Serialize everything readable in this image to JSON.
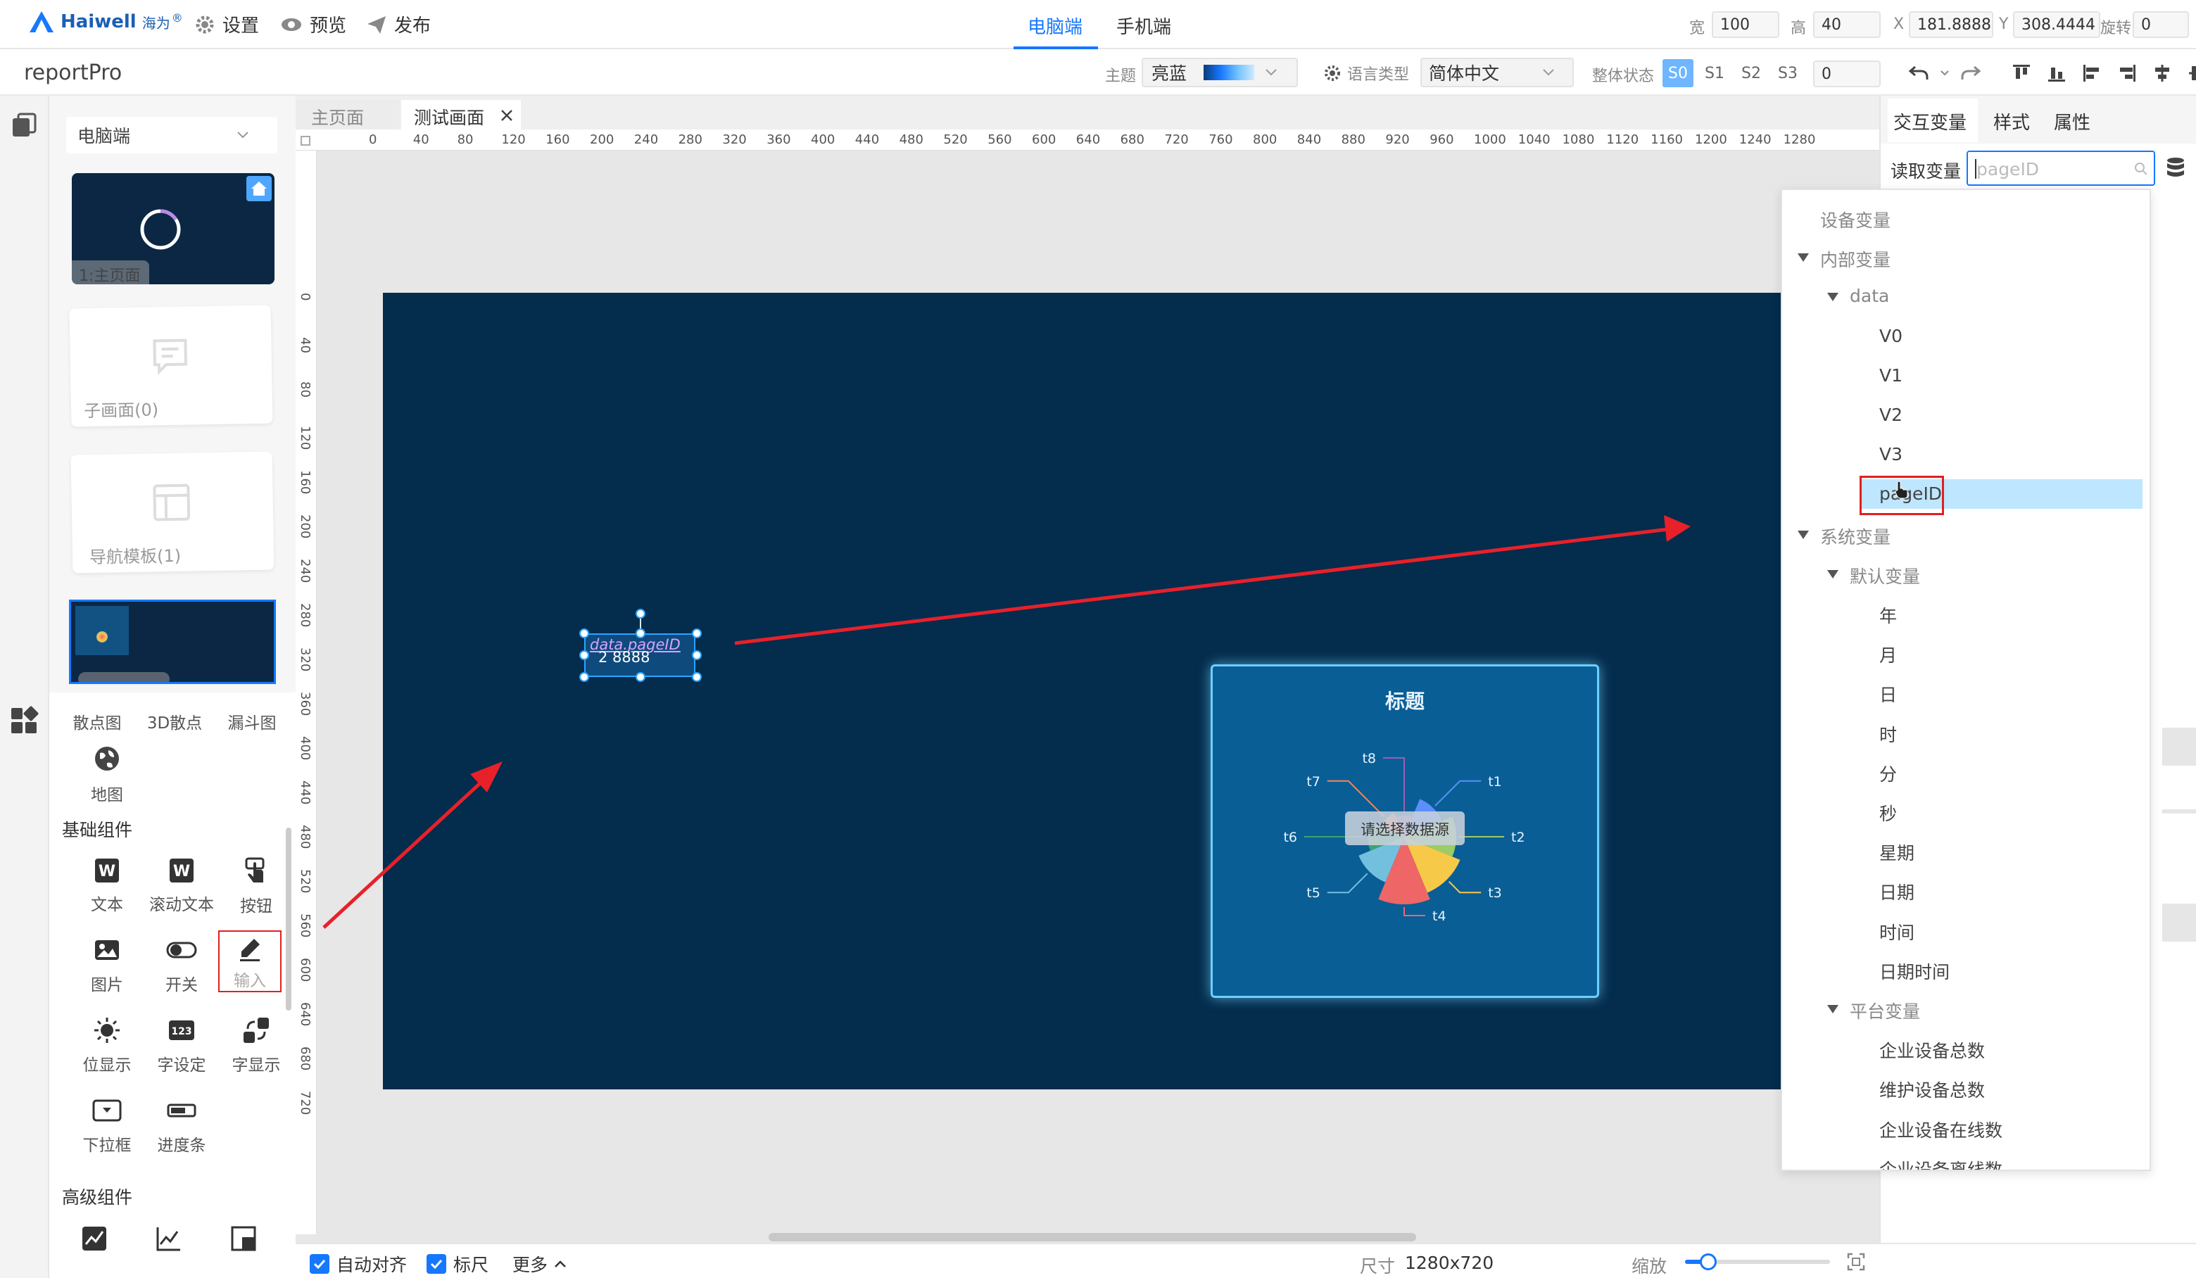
{
  "app": {
    "logo_text": "Haiwell",
    "logo_cn": "海为",
    "logo_mark": "®",
    "menu": {
      "settings": "设置",
      "preview": "预览",
      "publish": "发布"
    },
    "device_tabs": [
      {
        "label": "电脑端",
        "active": true
      },
      {
        "label": "手机端",
        "active": false
      }
    ],
    "project_name": "reportPro",
    "accent": "#1677ff"
  },
  "geometry_inputs": {
    "width_label": "宽",
    "width_value": "100",
    "height_label": "高",
    "height_value": "40",
    "x_label": "X",
    "x_value": "181.8888",
    "y_label": "Y",
    "y_value": "308.4444",
    "rotate_label": "旋转",
    "rotate_value": "0"
  },
  "toolbar": {
    "theme_label": "主题",
    "theme_value": "亮蓝",
    "lang_label": "语言类型",
    "lang_value": "简体中文",
    "state_label": "整体状态",
    "states": [
      "S0",
      "S1",
      "S2",
      "S3"
    ],
    "state_input": "0"
  },
  "left_panel": {
    "platform_select": "电脑端",
    "pages": [
      {
        "label": "1:主页面"
      },
      {
        "label": "子画面(0)"
      },
      {
        "label": "导航模板(1)"
      }
    ],
    "chart_components": [
      "散点图",
      "3D散点",
      "漏斗图"
    ],
    "map_component": "地图",
    "basic_title": "基础组件",
    "basic_components": [
      {
        "label": "文本",
        "icon": "word-icon"
      },
      {
        "label": "滚动文本",
        "icon": "word-icon"
      },
      {
        "label": "按钮",
        "icon": "hand-pointer-icon"
      },
      {
        "label": "图片",
        "icon": "image-icon"
      },
      {
        "label": "开关",
        "icon": "toggle-icon"
      },
      {
        "label": "输入",
        "icon": "pen-icon"
      },
      {
        "label": "位显示",
        "icon": "sun-icon"
      },
      {
        "label": "字设定",
        "icon": "number-123-icon"
      },
      {
        "label": "字显示",
        "icon": "cycle-icon"
      },
      {
        "label": "下拉框",
        "icon": "dropdown-icon"
      },
      {
        "label": "进度条",
        "icon": "progress-icon"
      }
    ],
    "advanced_title": "高级组件"
  },
  "page_tabs": [
    {
      "label": "主页面",
      "active": false
    },
    {
      "label": "测试画面",
      "active": true
    }
  ],
  "ruler_h": [
    "0",
    "40",
    "80",
    "120",
    "160",
    "200",
    "240",
    "280",
    "320",
    "360",
    "400",
    "440",
    "480",
    "520",
    "560",
    "600",
    "640",
    "680",
    "720",
    "760",
    "800",
    "840",
    "880",
    "920",
    "960",
    "1000",
    "1040",
    "1080",
    "1120",
    "1160",
    "1200",
    "1240",
    "1280"
  ],
  "ruler_v": [
    "0",
    "40",
    "80",
    "120",
    "160",
    "200",
    "240",
    "280",
    "320",
    "360",
    "400",
    "440",
    "480",
    "520",
    "560",
    "600",
    "640",
    "680",
    "720"
  ],
  "canvas": {
    "background": "#042c4c",
    "input_widget": {
      "text_top": "data.pageID",
      "text_bottom": "2  8888"
    },
    "chart_card": {
      "title": "标题",
      "placeholder": "请选择数据源"
    }
  },
  "chart_data": {
    "type": "pie",
    "title": "标题",
    "categories": [
      "t1",
      "t2",
      "t3",
      "t4",
      "t5",
      "t6",
      "t7",
      "t8"
    ],
    "colors": [
      "#5b8ff9",
      "#9ccc65",
      "#f7c948",
      "#ee6666",
      "#73c0de",
      "#3ba272",
      "#fc8452",
      "#9a60b4"
    ]
  },
  "right_panel": {
    "tabs": [
      {
        "label": "交互变量",
        "active": true
      },
      {
        "label": "样式",
        "active": false
      },
      {
        "label": "属性",
        "active": false
      }
    ],
    "read_var_label": "读取变量",
    "read_var_value": "pageID"
  },
  "var_tree": [
    {
      "label": "设备变量",
      "level": 0,
      "arrow": false
    },
    {
      "label": "内部变量",
      "level": 0,
      "arrow": true
    },
    {
      "label": "data",
      "level": 1,
      "arrow": true
    },
    {
      "label": "V0",
      "level": 2,
      "arrow": false
    },
    {
      "label": "V1",
      "level": 2,
      "arrow": false
    },
    {
      "label": "V2",
      "level": 2,
      "arrow": false
    },
    {
      "label": "V3",
      "level": 2,
      "arrow": false
    },
    {
      "label": "pageID",
      "level": 2,
      "arrow": false,
      "selected": true
    },
    {
      "label": "系统变量",
      "level": 0,
      "arrow": true
    },
    {
      "label": "默认变量",
      "level": 1,
      "arrow": true
    },
    {
      "label": "年",
      "level": 2,
      "arrow": false
    },
    {
      "label": "月",
      "level": 2,
      "arrow": false
    },
    {
      "label": "日",
      "level": 2,
      "arrow": false
    },
    {
      "label": "时",
      "level": 2,
      "arrow": false
    },
    {
      "label": "分",
      "level": 2,
      "arrow": false
    },
    {
      "label": "秒",
      "level": 2,
      "arrow": false
    },
    {
      "label": "星期",
      "level": 2,
      "arrow": false
    },
    {
      "label": "日期",
      "level": 2,
      "arrow": false
    },
    {
      "label": "时间",
      "level": 2,
      "arrow": false
    },
    {
      "label": "日期时间",
      "level": 2,
      "arrow": false
    },
    {
      "label": "平台变量",
      "level": 1,
      "arrow": true
    },
    {
      "label": "企业设备总数",
      "level": 2,
      "arrow": false
    },
    {
      "label": "维护设备总数",
      "level": 2,
      "arrow": false
    },
    {
      "label": "企业设备在线数",
      "level": 2,
      "arrow": false
    },
    {
      "label": "企业设备离线数",
      "level": 2,
      "arrow": false
    }
  ],
  "bottom": {
    "auto_align": "自动对齐",
    "ruler": "标尺",
    "more": "更多",
    "size_label": "尺寸",
    "size_value": "1280x720",
    "zoom_label": "缩放",
    "zoom_level": 0.16
  }
}
